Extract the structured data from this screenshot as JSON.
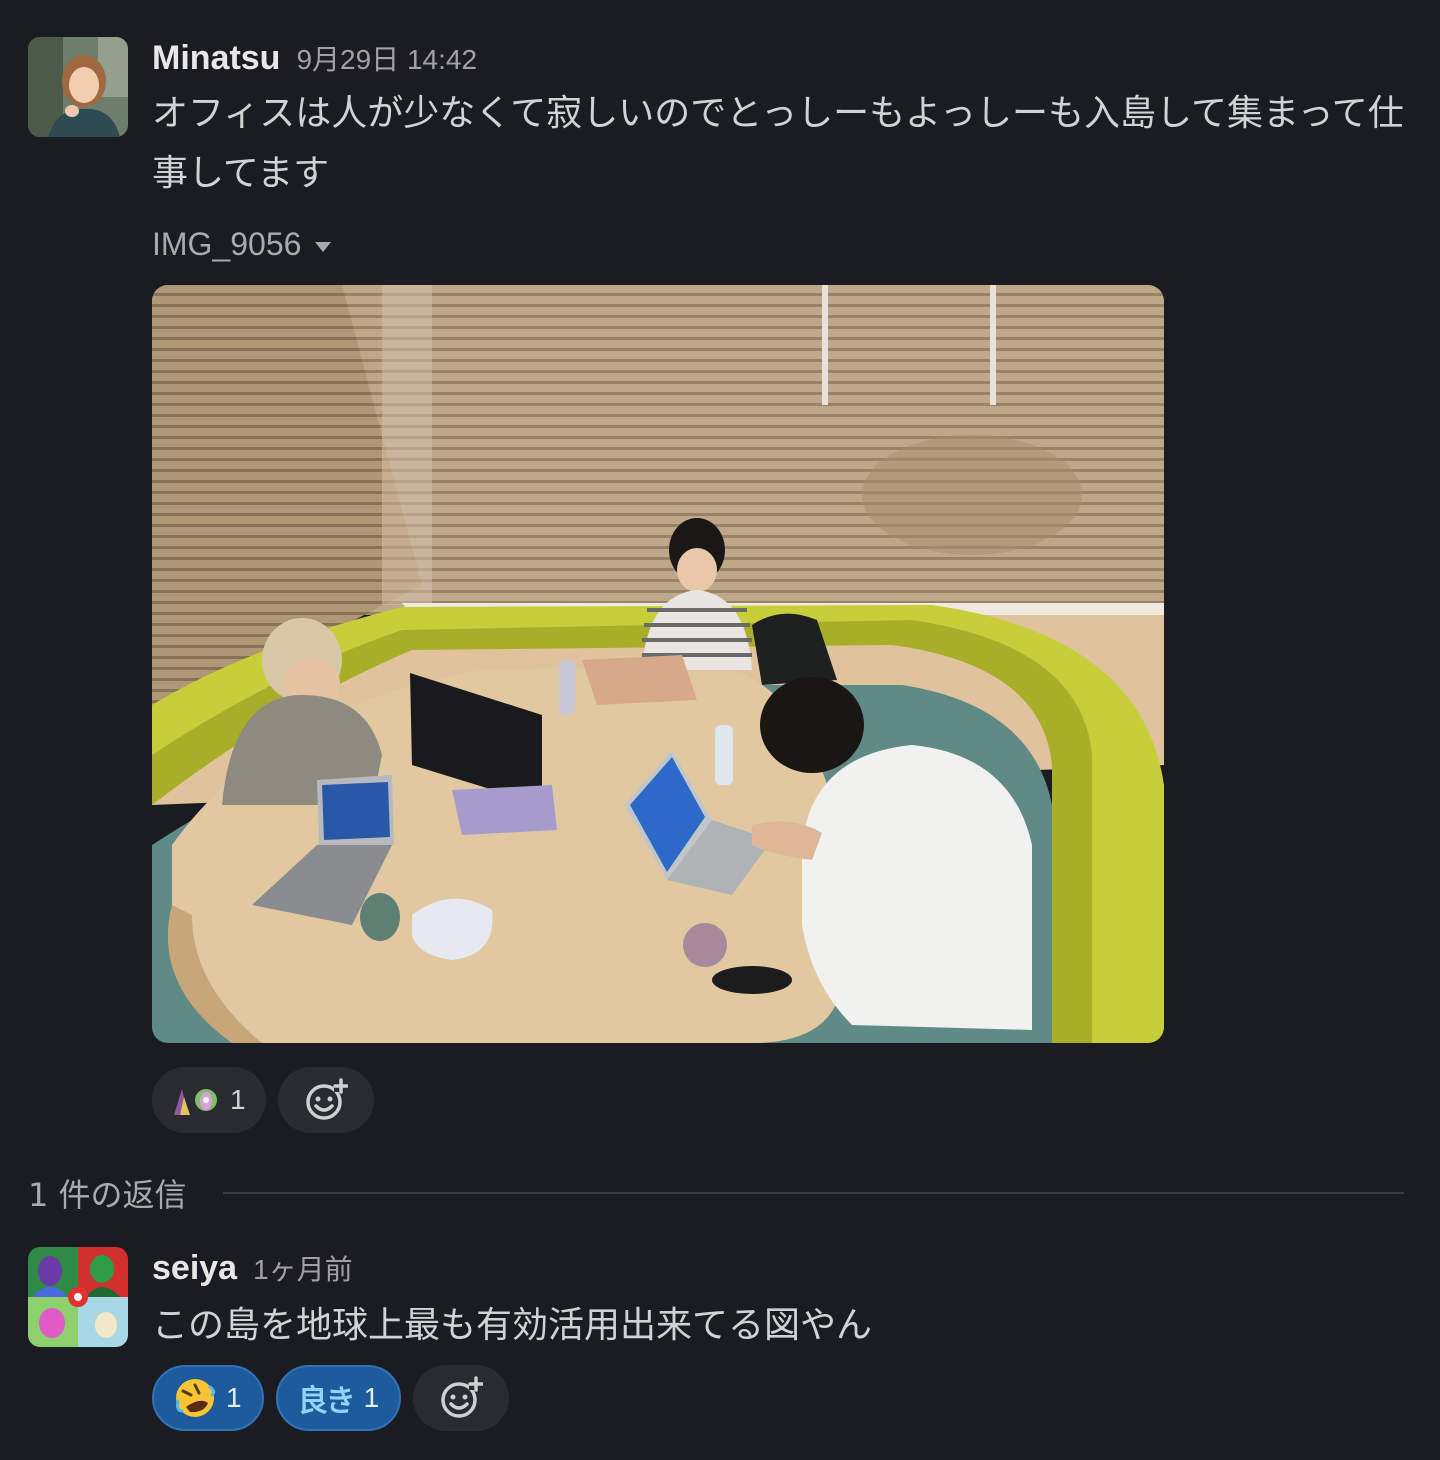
{
  "post": {
    "sender": "Minatsu",
    "timestamp": "9月29日 14:42",
    "text": "オフィスは人が少なくて寂しいのでとっしーもよっしーも入島して集まって仕事してます",
    "attachment": {
      "name": "IMG_9056"
    },
    "reactions": [
      {
        "emoji": "people-pair-emoji",
        "count": "1"
      }
    ]
  },
  "thread": {
    "reply_count_label": "1 件の返信"
  },
  "reply": {
    "sender": "seiya",
    "timestamp": "1ヶ月前",
    "text": "この島を地球上最も有効活用出来てる図やん",
    "reactions": [
      {
        "emoji": "rofl-emoji",
        "count": "1"
      },
      {
        "emoji": "yoki-text-emoji",
        "glyph": "良き",
        "count": "1"
      }
    ]
  },
  "colors": {
    "background": "#1b1c21",
    "reaction_active": "#1d5b9c",
    "reaction_neutral": "#2a2b30"
  }
}
